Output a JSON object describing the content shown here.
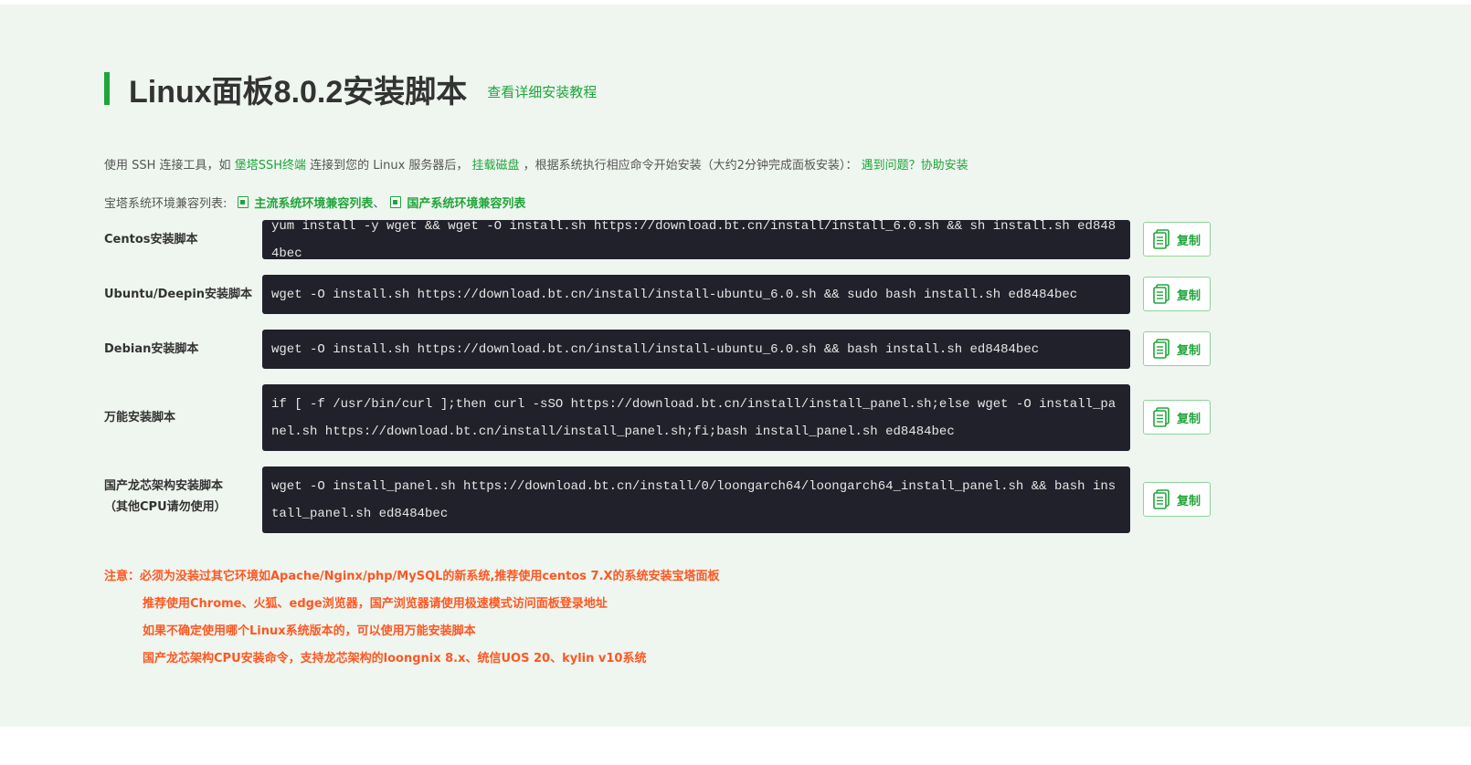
{
  "header": {
    "title": "Linux面板8.0.2安装脚本",
    "tutorial_link": "查看详细安装教程"
  },
  "intro": {
    "part1": "使用 SSH 连接工具，如 ",
    "ssh_link": "堡塔SSH终端",
    "part2": " 连接到您的 Linux 服务器后， ",
    "disk_link": "挂载磁盘",
    "part3": " ，根据系统执行相应命令开始安装（大约2分钟完成面板安装）： ",
    "help_link": "遇到问题？协助安装"
  },
  "compat": {
    "label": "宝塔系统环境兼容列表:",
    "mainstream_link": "主流系统环境兼容列表",
    "separator": "、",
    "domestic_link": "国产系统环境兼容列表"
  },
  "scripts": [
    {
      "label": "Centos安装脚本",
      "command": "yum install -y wget && wget -O install.sh https://download.bt.cn/install/install_6.0.sh && sh install.sh ed8484bec",
      "copy_label": "复制"
    },
    {
      "label": "Ubuntu/Deepin安装脚本",
      "command": "wget -O install.sh https://download.bt.cn/install/install-ubuntu_6.0.sh && sudo bash install.sh ed8484bec",
      "copy_label": "复制"
    },
    {
      "label": "Debian安装脚本",
      "command": "wget -O install.sh https://download.bt.cn/install/install-ubuntu_6.0.sh && bash install.sh ed8484bec",
      "copy_label": "复制"
    },
    {
      "label": "万能安装脚本",
      "command": "if [ -f /usr/bin/curl ];then curl -sSO https://download.bt.cn/install/install_panel.sh;else wget -O install_panel.sh https://download.bt.cn/install/install_panel.sh;fi;bash install_panel.sh ed8484bec",
      "copy_label": "复制"
    },
    {
      "label": "国产龙芯架构安装脚本",
      "label_line2": "（其他CPU请勿使用）",
      "command": "wget -O install_panel.sh https://download.bt.cn/install/0/loongarch64/loongarch64_install_panel.sh && bash install_panel.sh ed8484bec",
      "copy_label": "复制"
    }
  ],
  "notes": [
    "注意：必须为没装过其它环境如Apache/Nginx/php/MySQL的新系统,推荐使用centos 7.X的系统安装宝塔面板",
    "推荐使用Chrome、火狐、edge浏览器，国产浏览器请使用极速模式访问面板登录地址",
    "如果不确定使用哪个Linux系统版本的，可以使用万能安装脚本",
    "国产龙芯架构CPU安装命令，支持龙芯架构的loongnix 8.x、统信UOS 20、kylin v10系统"
  ],
  "colors": {
    "accent": "#20a53a",
    "warning": "#ff5722",
    "code_bg": "#21212b"
  }
}
